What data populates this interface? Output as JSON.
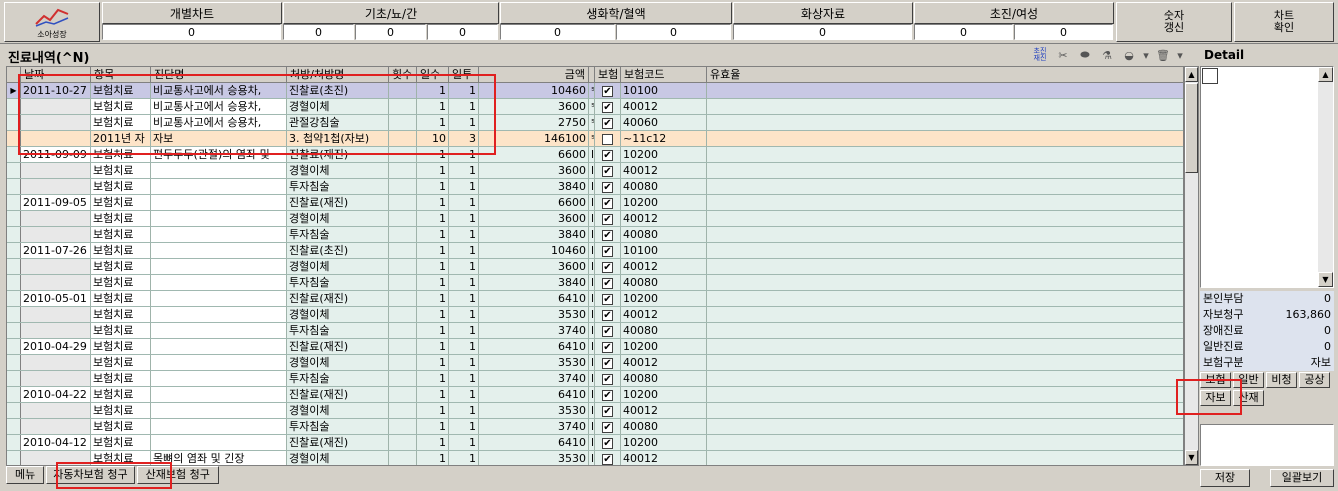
{
  "toolbar": {
    "logo_label": "소아성장",
    "groups": [
      {
        "title": "개별차트",
        "values": [
          "0"
        ]
      },
      {
        "title": "기초/뇨/간",
        "values": [
          "0",
          "0",
          "0"
        ]
      },
      {
        "title": "생화학/혈액",
        "values": [
          "0",
          "0"
        ]
      },
      {
        "title": "화상자료",
        "values": [
          "0"
        ]
      },
      {
        "title": "초진/여성",
        "values": [
          "0",
          "0"
        ]
      }
    ],
    "btn_refresh": "숫자\n갱신",
    "btn_chart": "차트\n확인"
  },
  "panel": {
    "title": "진료내역(^N)",
    "icons": [
      "scissors-icon",
      "pill-icon",
      "mortar-icon",
      "trash-icon"
    ],
    "icon_label": "초진\n재진"
  },
  "grid": {
    "headers": [
      "날짜",
      "항목",
      "진단명",
      "처방/처방명",
      "횟수",
      "일수",
      "일투",
      "금액",
      "",
      "보험",
      "보험코드",
      "유효율"
    ],
    "rows": [
      {
        "date": "2011-10-27",
        "item": "보험치료",
        "diag": "비교통사고에서 승용차,",
        "rx": "진찰료(초진)",
        "cnt": "",
        "days": "1",
        "daily": "1",
        "amt": "10460",
        "f": "ˢ",
        "ins": true,
        "code": "10100",
        "style": "sel"
      },
      {
        "date": "",
        "item": "보험치료",
        "diag": "비교통사고에서 승용차,",
        "rx": "경혈이체",
        "cnt": "",
        "days": "1",
        "daily": "1",
        "amt": "3600",
        "f": "ˢ",
        "ins": true,
        "code": "40012",
        "style": "zebra"
      },
      {
        "date": "",
        "item": "보험치료",
        "diag": "비교통사고에서 승용차,",
        "rx": "관절강침술",
        "cnt": "",
        "days": "1",
        "daily": "1",
        "amt": "2750",
        "f": "ˢ",
        "ins": true,
        "code": "40060",
        "style": "zebra"
      },
      {
        "date": "",
        "item": "2011년 자",
        "diag": "자보",
        "rx": "3. 첩약1첩(자보)",
        "cnt": "",
        "days": "10",
        "daily": "3",
        "amt": "146100",
        "f": "ˢ",
        "ins": false,
        "code": "~11c12",
        "style": "peach"
      },
      {
        "date": "2011-09-09",
        "item": "보험치료",
        "diag": "편두두두(관절)의 염좌 및",
        "rx": "진찰료(재진)",
        "cnt": "",
        "days": "1",
        "daily": "1",
        "amt": "6600",
        "f": "l",
        "ins": true,
        "code": "10200",
        "style": "zebra"
      },
      {
        "date": "",
        "item": "보험치료",
        "diag": "",
        "rx": "경혈이체",
        "cnt": "",
        "days": "1",
        "daily": "1",
        "amt": "3600",
        "f": "l",
        "ins": true,
        "code": "40012",
        "style": "zebra"
      },
      {
        "date": "",
        "item": "보험치료",
        "diag": "",
        "rx": "투자침술",
        "cnt": "",
        "days": "1",
        "daily": "1",
        "amt": "3840",
        "f": "l",
        "ins": true,
        "code": "40080",
        "style": "zebra"
      },
      {
        "date": "2011-09-05",
        "item": "보험치료",
        "diag": "",
        "rx": "진찰료(재진)",
        "cnt": "",
        "days": "1",
        "daily": "1",
        "amt": "6600",
        "f": "l",
        "ins": true,
        "code": "10200",
        "style": "zebra"
      },
      {
        "date": "",
        "item": "보험치료",
        "diag": "",
        "rx": "경혈이체",
        "cnt": "",
        "days": "1",
        "daily": "1",
        "amt": "3600",
        "f": "l",
        "ins": true,
        "code": "40012",
        "style": "zebra"
      },
      {
        "date": "",
        "item": "보험치료",
        "diag": "",
        "rx": "투자침술",
        "cnt": "",
        "days": "1",
        "daily": "1",
        "amt": "3840",
        "f": "l",
        "ins": true,
        "code": "40080",
        "style": "zebra"
      },
      {
        "date": "2011-07-26",
        "item": "보험치료",
        "diag": "",
        "rx": "진찰료(초진)",
        "cnt": "",
        "days": "1",
        "daily": "1",
        "amt": "10460",
        "f": "l",
        "ins": true,
        "code": "10100",
        "style": "zebra"
      },
      {
        "date": "",
        "item": "보험치료",
        "diag": "",
        "rx": "경혈이체",
        "cnt": "",
        "days": "1",
        "daily": "1",
        "amt": "3600",
        "f": "l",
        "ins": true,
        "code": "40012",
        "style": "zebra"
      },
      {
        "date": "",
        "item": "보험치료",
        "diag": "",
        "rx": "투자침술",
        "cnt": "",
        "days": "1",
        "daily": "1",
        "amt": "3840",
        "f": "l",
        "ins": true,
        "code": "40080",
        "style": "zebra"
      },
      {
        "date": "2010-05-01",
        "item": "보험치료",
        "diag": "",
        "rx": "진찰료(재진)",
        "cnt": "",
        "days": "1",
        "daily": "1",
        "amt": "6410",
        "f": "l",
        "ins": true,
        "code": "10200",
        "style": "zebra"
      },
      {
        "date": "",
        "item": "보험치료",
        "diag": "",
        "rx": "경혈이체",
        "cnt": "",
        "days": "1",
        "daily": "1",
        "amt": "3530",
        "f": "l",
        "ins": true,
        "code": "40012",
        "style": "zebra"
      },
      {
        "date": "",
        "item": "보험치료",
        "diag": "",
        "rx": "투자침술",
        "cnt": "",
        "days": "1",
        "daily": "1",
        "amt": "3740",
        "f": "l",
        "ins": true,
        "code": "40080",
        "style": "zebra"
      },
      {
        "date": "2010-04-29",
        "item": "보험치료",
        "diag": "",
        "rx": "진찰료(재진)",
        "cnt": "",
        "days": "1",
        "daily": "1",
        "amt": "6410",
        "f": "l",
        "ins": true,
        "code": "10200",
        "style": "zebra"
      },
      {
        "date": "",
        "item": "보험치료",
        "diag": "",
        "rx": "경혈이체",
        "cnt": "",
        "days": "1",
        "daily": "1",
        "amt": "3530",
        "f": "l",
        "ins": true,
        "code": "40012",
        "style": "zebra"
      },
      {
        "date": "",
        "item": "보험치료",
        "diag": "",
        "rx": "투자침술",
        "cnt": "",
        "days": "1",
        "daily": "1",
        "amt": "3740",
        "f": "l",
        "ins": true,
        "code": "40080",
        "style": "zebra"
      },
      {
        "date": "2010-04-22",
        "item": "보험치료",
        "diag": "",
        "rx": "진찰료(재진)",
        "cnt": "",
        "days": "1",
        "daily": "1",
        "amt": "6410",
        "f": "l",
        "ins": true,
        "code": "10200",
        "style": "zebra"
      },
      {
        "date": "",
        "item": "보험치료",
        "diag": "",
        "rx": "경혈이체",
        "cnt": "",
        "days": "1",
        "daily": "1",
        "amt": "3530",
        "f": "l",
        "ins": true,
        "code": "40012",
        "style": "zebra"
      },
      {
        "date": "",
        "item": "보험치료",
        "diag": "",
        "rx": "투자침술",
        "cnt": "",
        "days": "1",
        "daily": "1",
        "amt": "3740",
        "f": "l",
        "ins": true,
        "code": "40080",
        "style": "zebra"
      },
      {
        "date": "2010-04-12",
        "item": "보험치료",
        "diag": "",
        "rx": "진찰료(재진)",
        "cnt": "",
        "days": "1",
        "daily": "1",
        "amt": "6410",
        "f": "l",
        "ins": true,
        "code": "10200",
        "style": "zebra"
      },
      {
        "date": "",
        "item": "보험치료",
        "diag": "목뼈의 염좌 및 긴장",
        "rx": "경혈이체",
        "cnt": "",
        "days": "1",
        "daily": "1",
        "amt": "3530",
        "f": "l",
        "ins": true,
        "code": "40012",
        "style": "zebra"
      }
    ]
  },
  "detail": {
    "title": "Detail",
    "summary": [
      {
        "k": "본인부담",
        "v": "0"
      },
      {
        "k": "자보청구",
        "v": "163,860"
      },
      {
        "k": "장애진료",
        "v": "0"
      },
      {
        "k": "일반진료",
        "v": "0"
      },
      {
        "k": "보험구분",
        "v": "자보"
      }
    ],
    "ins_buttons": [
      "보험",
      "일반",
      "비청",
      "공상",
      "자보",
      "산재"
    ],
    "save": "저장",
    "bulk_view": "일괄보기"
  },
  "tabs": [
    "메뉴",
    "자동차보험 청구",
    "산재보험 청구"
  ],
  "colors": {
    "highlight": "#e02020",
    "selected_row": "#c8c8e4",
    "zebra": "#e4f0ec",
    "peach": "#fde4c8"
  }
}
